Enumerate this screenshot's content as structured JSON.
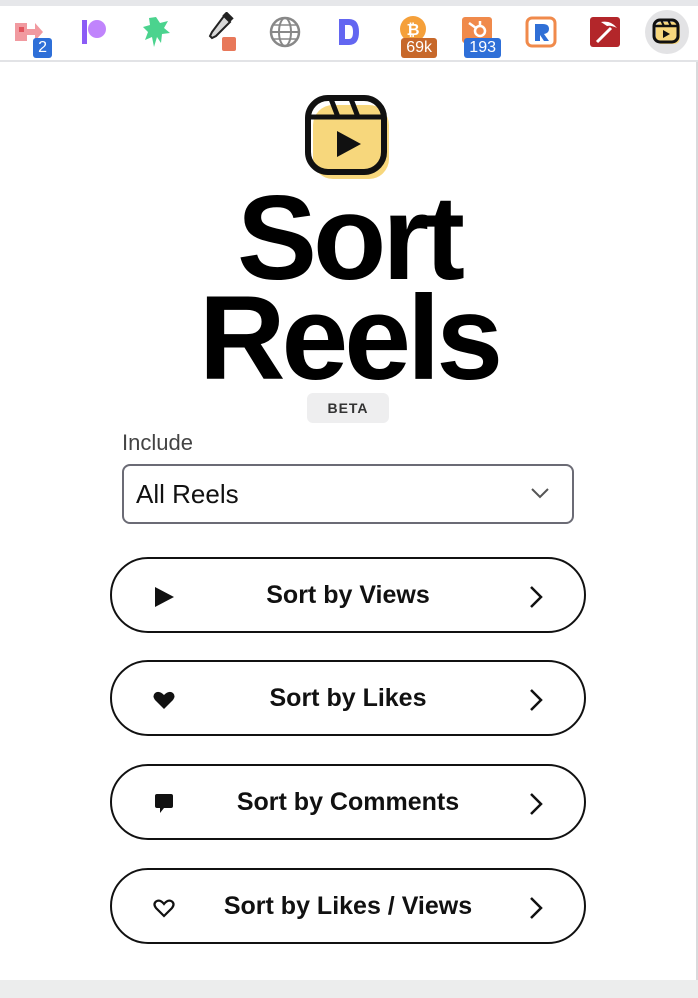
{
  "toolbar": {
    "extensions": [
      {
        "icon": "flag-arrow-icon",
        "badge": "2",
        "badge_color": "#2e6fd8"
      },
      {
        "icon": "patreon-p-icon"
      },
      {
        "icon": "green-fern-icon"
      },
      {
        "icon": "eyedropper-icon",
        "swatch_color": "#e8785a"
      },
      {
        "icon": "globe-icon"
      },
      {
        "icon": "d-letter-icon"
      },
      {
        "icon": "bitcoin-icon",
        "badge": "69k",
        "badge_color": "#c7682a"
      },
      {
        "icon": "hubspot-icon",
        "badge": "193",
        "badge_color": "#2e6fd8"
      },
      {
        "icon": "r-square-icon"
      },
      {
        "icon": "pickaxe-icon"
      },
      {
        "icon": "reels-icon",
        "active": true
      }
    ]
  },
  "app": {
    "title_line1": "Sort",
    "title_line2": "Reels",
    "beta_label": "BETA",
    "logo_icon": "reels-logo-icon",
    "logo_fill": "#f7d77c"
  },
  "include": {
    "label": "Include",
    "value": "All Reels"
  },
  "buttons": {
    "views": {
      "label": "Sort by Views",
      "icon": "play-icon"
    },
    "likes": {
      "label": "Sort by Likes",
      "icon": "heart-filled-icon"
    },
    "comments": {
      "label": "Sort by Comments",
      "icon": "comment-icon"
    },
    "ratio": {
      "label": "Sort by Likes / Views",
      "icon": "heart-outline-icon"
    }
  }
}
